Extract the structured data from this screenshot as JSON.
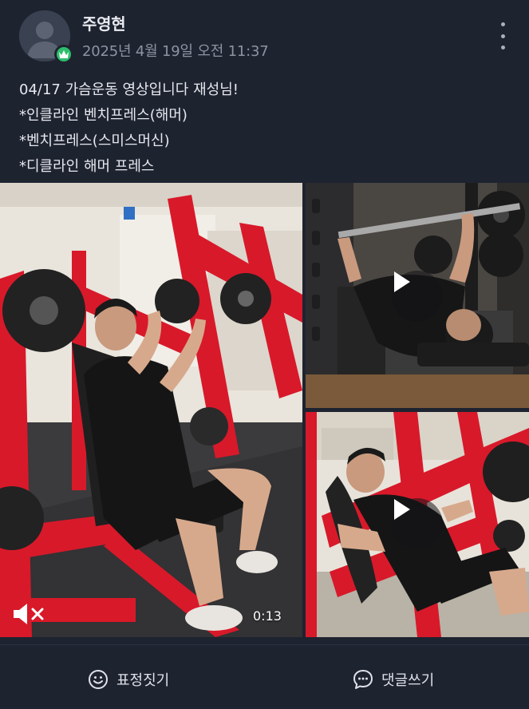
{
  "post": {
    "author": "주영현",
    "timestamp": "2025년 4월 19일 오전 11:37",
    "author_badge_icon": "crown-icon",
    "body_lines": [
      "04/17 가슴운동 영상입니다 재성님!",
      "*인클라인 벤치프레스(해머)",
      "*벤치프레스(스미스머신)",
      "*디클라인 해머 프레스"
    ]
  },
  "media": {
    "main_video": {
      "duration": "0:13",
      "muted": true
    },
    "thumb_1": {
      "type": "video"
    },
    "thumb_2": {
      "type": "video"
    }
  },
  "actions": {
    "react_label": "표정짓기",
    "comment_label": "댓글쓰기"
  },
  "colors": {
    "background": "#1e2330",
    "badge": "#2dbf6c",
    "machine_red": "#d8192a"
  }
}
